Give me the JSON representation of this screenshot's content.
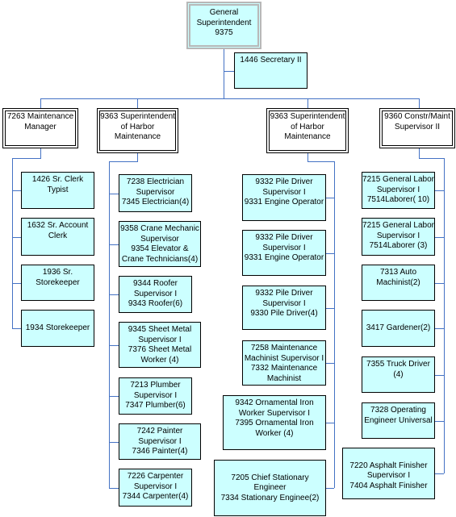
{
  "root": {
    "lines": [
      "General",
      "Superintendent",
      "9375"
    ]
  },
  "secretary": {
    "lines": [
      "1446 Secretary II"
    ]
  },
  "departments": [
    {
      "head": {
        "lines": [
          "7263 Maintenance",
          "Manager"
        ]
      },
      "staff": [
        {
          "lines": [
            "1426 Sr. Clerk",
            "Typist"
          ]
        },
        {
          "lines": [
            "1632 Sr. Account",
            "Clerk"
          ]
        },
        {
          "lines": [
            "1936 Sr.",
            "Storekeeper"
          ]
        },
        {
          "lines": [
            "",
            "1934 Storekeeper"
          ]
        }
      ]
    },
    {
      "head": {
        "lines": [
          "9363 Superintendent",
          "of Harbor",
          "Maintenance"
        ]
      },
      "staff": [
        {
          "lines": [
            "7238 Electrician",
            "Supervisor",
            "7345 Electrician(4)"
          ]
        },
        {
          "lines": [
            "9358 Crane Mechanic",
            "Supervisor",
            "9354 Elevator &",
            "Crane Technicians(4)"
          ]
        },
        {
          "lines": [
            "9344 Roofer",
            "Supervisor I",
            "9343 Roofer(6)"
          ]
        },
        {
          "lines": [
            "9345 Sheet Metal",
            "Supervisor I",
            "7376 Sheet Metal",
            "Worker (4)"
          ]
        },
        {
          "lines": [
            "7213 Plumber",
            "Supervisor I",
            "7347 Plumber(6)"
          ]
        },
        {
          "lines": [
            "7242 Painter",
            "Supervisor I",
            "7346 Painter(4)"
          ]
        },
        {
          "lines": [
            "7226 Carpenter",
            "Supervisor I",
            "7344 Carpenter(4)"
          ]
        }
      ]
    },
    {
      "head": {
        "lines": [
          "9363 Superintendent",
          "of Harbor",
          "Maintenance"
        ]
      },
      "staff": [
        {
          "lines": [
            "9332 Pile Driver",
            "Supervisor I",
            "9331 Engine Operator"
          ]
        },
        {
          "lines": [
            "9332 Pile Driver",
            "Supervisor I",
            "9331 Engine Operator"
          ]
        },
        {
          "lines": [
            "9332 Pile Driver",
            "Supervisor I",
            "9330 Pile Driver(4)"
          ]
        },
        {
          "lines": [
            "7258 Maintenance",
            "Machinist Supervisor I",
            "7332 Maintenance",
            "Machinist"
          ]
        },
        {
          "lines": [
            "9342 Ornamental Iron",
            "Worker Supervisor I",
            "7395 Ornamental Iron",
            "Worker (4)"
          ]
        },
        {
          "lines": [
            "",
            "7205 Chief Stationary",
            "Engineer",
            "7334 Stationary Enginee(2)"
          ]
        }
      ]
    },
    {
      "head": {
        "lines": [
          "9360 Constr/Maint",
          "Supervisor II"
        ]
      },
      "staff": [
        {
          "lines": [
            "7215 General Labor",
            "Supervisor I",
            "7514Laborer( 10)"
          ]
        },
        {
          "lines": [
            "7215 General Labor",
            "Supervisor I",
            "7514Laborer (3)"
          ]
        },
        {
          "lines": [
            "7313 Auto",
            "Machinist(2)"
          ]
        },
        {
          "lines": [
            "",
            "3417 Gardener(2)"
          ]
        },
        {
          "lines": [
            "7355 Truck Driver",
            "(4)"
          ]
        },
        {
          "lines": [
            "7328 Operating",
            "Engineer Universal"
          ]
        },
        {
          "lines": [
            "",
            "7220 Asphalt Finisher",
            "Supervisor I",
            "7404 Asphalt Finisher"
          ]
        }
      ]
    }
  ],
  "colors": {
    "box_fill": "#ccffff",
    "connector": "#4472c4"
  }
}
